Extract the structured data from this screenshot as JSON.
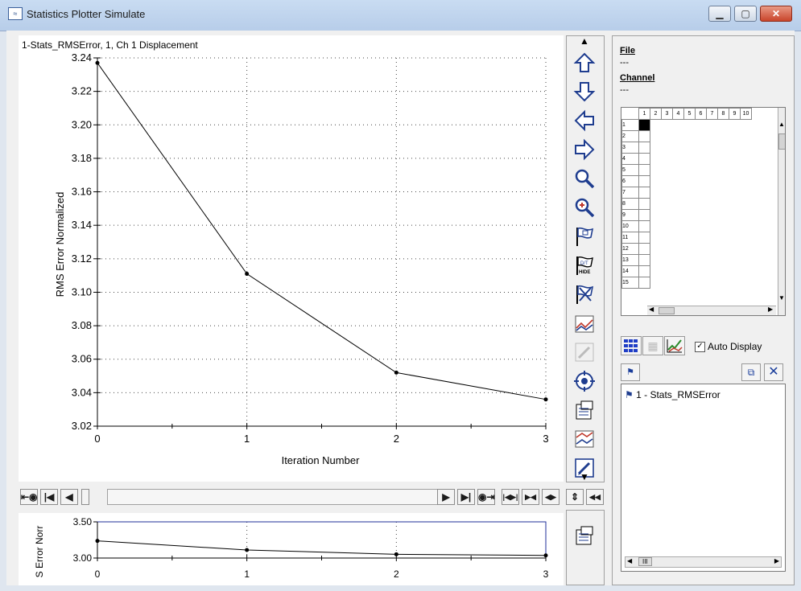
{
  "window": {
    "title": "Statistics Plotter Simulate"
  },
  "main_plot": {
    "title": "1-Stats_RMSError, 1, Ch 1 Displacement",
    "ylabel": "RMS Error Normalized",
    "xlabel": "Iteration Number"
  },
  "chart_data": [
    {
      "type": "line",
      "title": "1-Stats_RMSError, 1, Ch 1 Displacement",
      "xlabel": "Iteration Number",
      "ylabel": "RMS Error Normalized",
      "x": [
        0,
        1,
        2,
        3
      ],
      "series": [
        {
          "values": [
            3.237,
            3.111,
            3.052,
            3.036
          ]
        }
      ],
      "xlim": [
        0,
        3
      ],
      "ylim": [
        3.02,
        3.24
      ],
      "yticks": [
        "3.02",
        "3.04",
        "3.06",
        "3.08",
        "3.10",
        "3.12",
        "3.14",
        "3.16",
        "3.18",
        "3.20",
        "3.22",
        "3.24"
      ],
      "xticks": [
        "0",
        "1",
        "2",
        "3"
      ],
      "grid": true
    },
    {
      "type": "line",
      "ylabel": "S Error Norr",
      "x": [
        0,
        1,
        2,
        3
      ],
      "series": [
        {
          "values": [
            3.237,
            3.111,
            3.052,
            3.036
          ]
        }
      ],
      "xlim": [
        0,
        3
      ],
      "ylim": [
        3.0,
        3.5
      ],
      "yticks": [
        "3.00",
        "3.50"
      ],
      "xticks": [
        "0",
        "1",
        "2",
        "3"
      ],
      "grid": true
    }
  ],
  "scroll_buttons": {
    "left": [
      "⇤◉",
      "|◀",
      "◀"
    ],
    "right": [
      "▶",
      "▶|",
      "◉⇥"
    ],
    "zoom": [
      "|◀▶|",
      "▶◀",
      "◀▶"
    ],
    "extra": [
      "⇕",
      "◀◀"
    ]
  },
  "right_panel": {
    "file_label": "File",
    "file_value": "---",
    "channel_label": "Channel",
    "channel_value": "---",
    "grid_columns": [
      "1",
      "2",
      "3",
      "4",
      "5",
      "6",
      "7",
      "8",
      "9",
      "10"
    ],
    "grid_rows": [
      "1",
      "2",
      "3",
      "4",
      "5",
      "6",
      "7",
      "8",
      "9",
      "10",
      "11",
      "12",
      "13",
      "14",
      "15"
    ],
    "auto_display_label": "Auto Display",
    "auto_display_checked": true,
    "list_items": [
      "1 - Stats_RMSError"
    ],
    "list_hscroll_label": "III"
  },
  "colors": {
    "accent": "#1f3d8f",
    "titlebar": "#c9dcf2",
    "close": "#c9452b"
  }
}
